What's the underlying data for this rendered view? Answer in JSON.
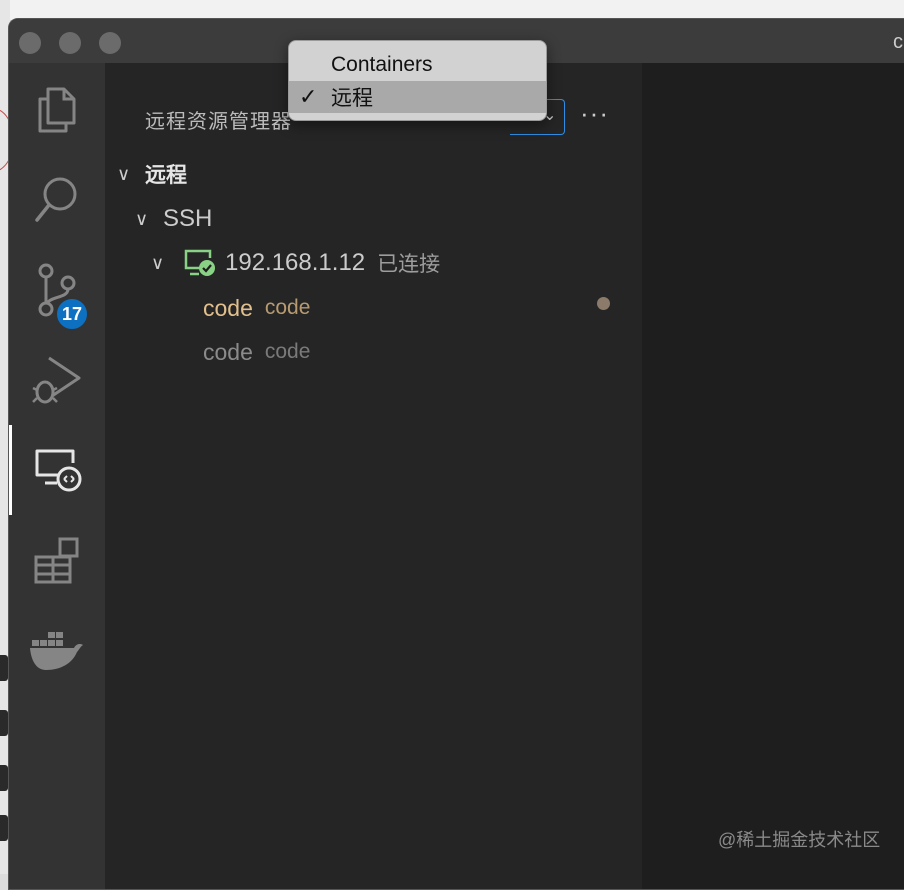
{
  "window": {
    "title_fragment": "c"
  },
  "activity_bar": {
    "items": [
      {
        "icon": "files-icon"
      },
      {
        "icon": "search-icon"
      },
      {
        "icon": "source-control-icon",
        "badge": "17"
      },
      {
        "icon": "run-debug-icon"
      },
      {
        "icon": "remote-explorer-icon",
        "active": true
      },
      {
        "icon": "extensions-icon"
      },
      {
        "icon": "docker-icon"
      }
    ]
  },
  "sidebar": {
    "title": "远程资源管理器",
    "more": "···",
    "section_label": "远程",
    "group_label": "SSH",
    "host": {
      "label": "192.168.1.12",
      "status": "已连接"
    },
    "items": [
      {
        "name": "code",
        "desc": "code",
        "color": "#e2c08d",
        "desc_color": "#b89a70",
        "dirty": true
      },
      {
        "name": "code",
        "desc": "code",
        "color": "#8b8b8b",
        "desc_color": "#7a7a7a",
        "dirty": false
      }
    ]
  },
  "dropdown": {
    "options": [
      {
        "label": "Containers",
        "selected": false
      },
      {
        "label": "远程",
        "selected": true
      }
    ],
    "check": "✓"
  },
  "watermark": "@稀土掘金技术社区",
  "colors": {
    "accent": "#0e70c0",
    "focus_border": "#2f8de4",
    "connected_green": "#89d185"
  }
}
